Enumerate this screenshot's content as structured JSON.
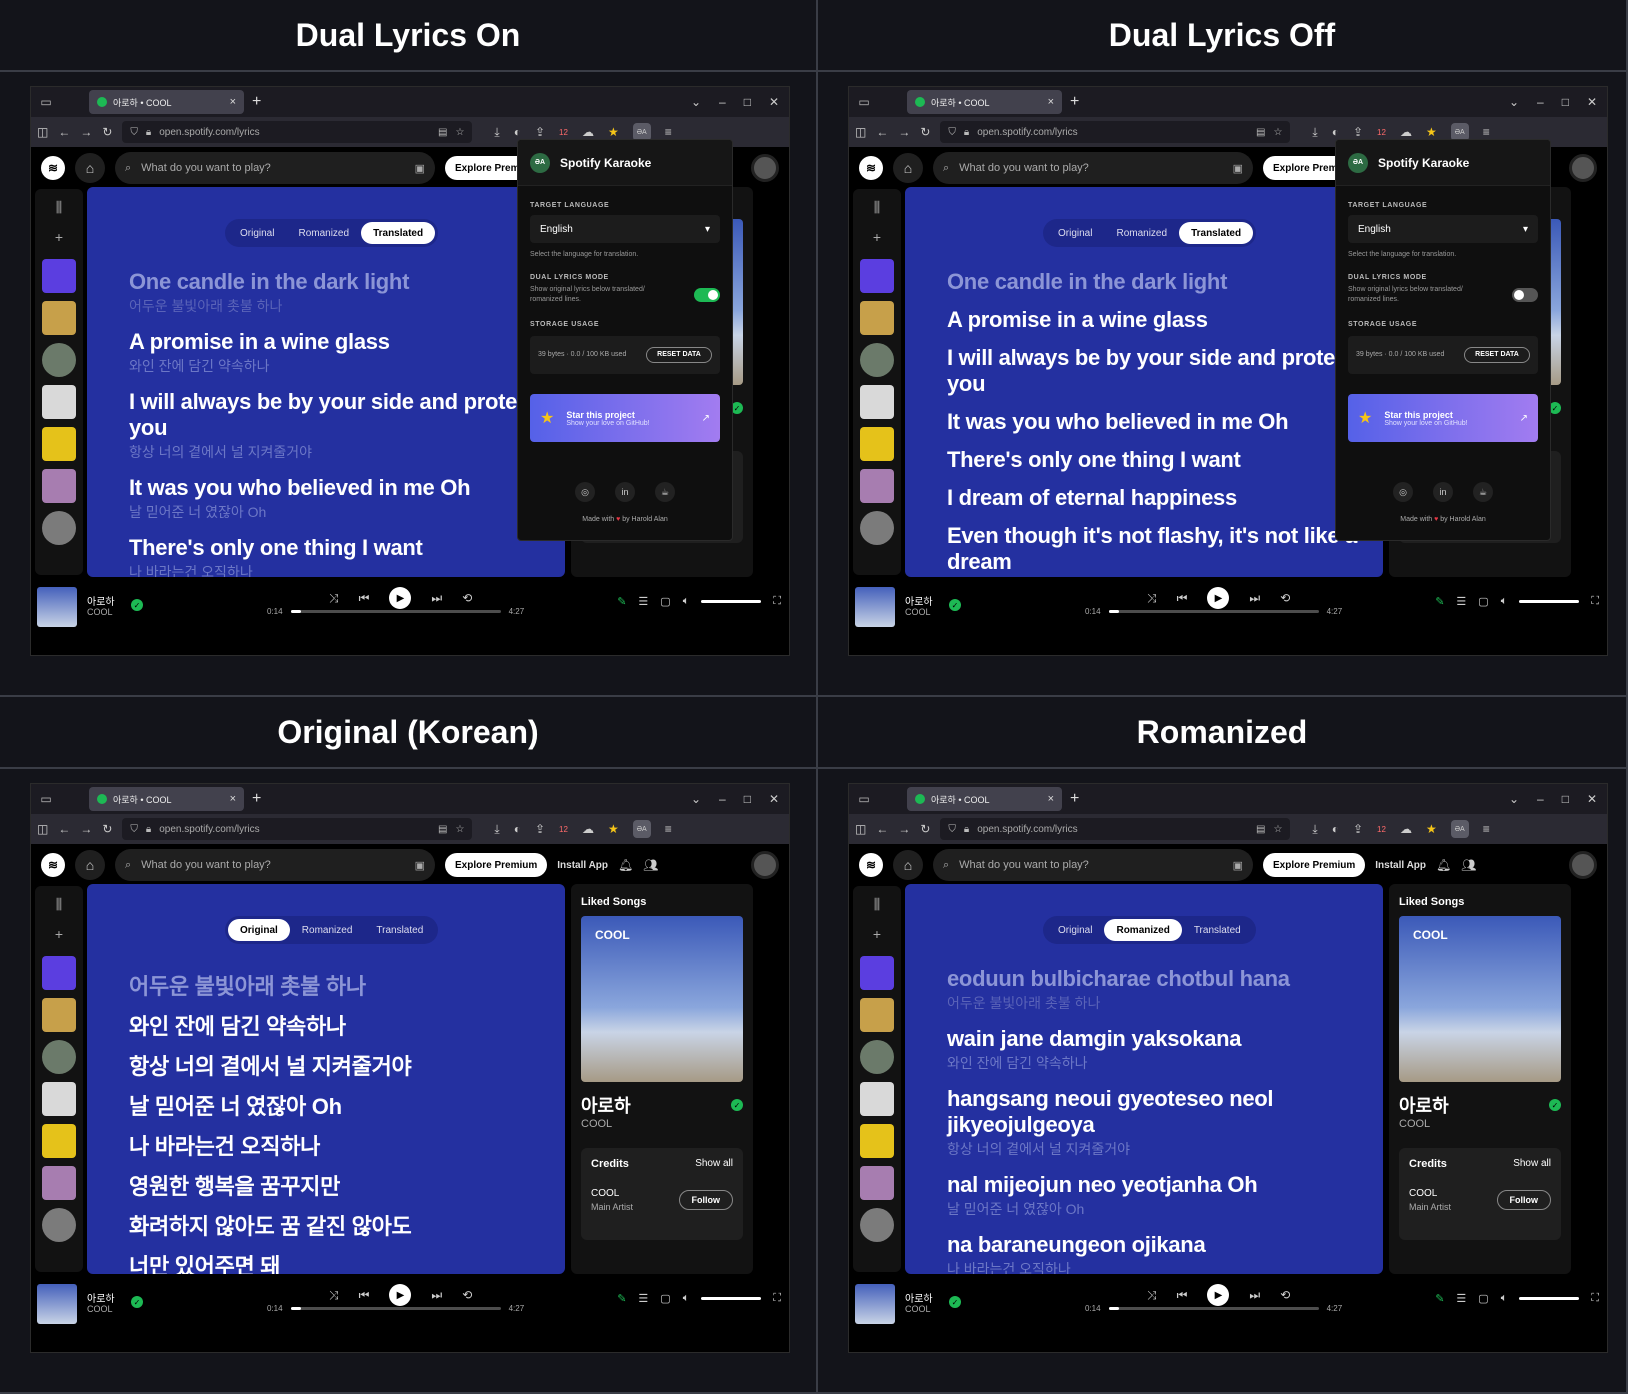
{
  "panels": [
    {
      "heading": "Dual Lyrics On",
      "segment": [
        "Original",
        "Romanized",
        "Translated"
      ],
      "active_segment": 2,
      "lyrics": [
        {
          "main": "One candle in the dark light",
          "sub": "어두운 불빛아래 촛불 하나",
          "dim": true
        },
        {
          "main": "A promise in a wine glass",
          "sub": "와인 잔에 담긴 약속하나",
          "dim": false
        },
        {
          "main": "I will always be by your side and protect you",
          "sub": "항상 너의 곁에서 널 지켜줄거야",
          "dim": false
        },
        {
          "main": "It was you who believed in me Oh",
          "sub": "날 믿어준 너 였잖아 Oh",
          "dim": false
        },
        {
          "main": "There's only one thing I want",
          "sub": "나 바라는건 오직하나",
          "dim": false
        }
      ],
      "popup": true,
      "dual_on": true
    },
    {
      "heading": "Dual Lyrics Off",
      "segment": [
        "Original",
        "Romanized",
        "Translated"
      ],
      "active_segment": 2,
      "lyrics": [
        {
          "main": "One candle in the dark light",
          "sub": "",
          "dim": true
        },
        {
          "main": "A promise in a wine glass",
          "sub": "",
          "dim": false
        },
        {
          "main": "I will always be by your side and protect you",
          "sub": "",
          "dim": false
        },
        {
          "main": "It was you who believed in me Oh",
          "sub": "",
          "dim": false
        },
        {
          "main": "There's only one thing I want",
          "sub": "",
          "dim": false
        },
        {
          "main": "I dream of eternal happiness",
          "sub": "",
          "dim": false
        },
        {
          "main": "Even though it's not flashy, it's not like a dream",
          "sub": "",
          "dim": false
        }
      ],
      "popup": true,
      "dual_on": false
    },
    {
      "heading": "Original (Korean)",
      "segment": [
        "Original",
        "Romanized",
        "Translated"
      ],
      "active_segment": 0,
      "lyrics": [
        {
          "main": "어두운 불빛아래 촛불 하나",
          "sub": "",
          "dim": true
        },
        {
          "main": "와인 잔에 담긴 약속하나",
          "sub": "",
          "dim": false
        },
        {
          "main": "항상 너의 곁에서 널 지켜줄거야",
          "sub": "",
          "dim": false
        },
        {
          "main": "날 믿어준 너 였잖아 Oh",
          "sub": "",
          "dim": false
        },
        {
          "main": "나 바라는건 오직하나",
          "sub": "",
          "dim": false
        },
        {
          "main": "영원한 행복을 꿈꾸지만",
          "sub": "",
          "dim": false
        },
        {
          "main": "화려하지 않아도 꿈 같진 않아도",
          "sub": "",
          "dim": false
        },
        {
          "main": "너만 있어주면 돼",
          "sub": "",
          "dim": false
        }
      ],
      "popup": false,
      "dual_on": false
    },
    {
      "heading": "Romanized",
      "segment": [
        "Original",
        "Romanized",
        "Translated"
      ],
      "active_segment": 1,
      "lyrics": [
        {
          "main": "eoduun bulbicharae chotbul hana",
          "sub": "어두운 불빛아래 촛불 하나",
          "dim": true
        },
        {
          "main": "wain jane damgin yaksokana",
          "sub": "와인 잔에 담긴 약속하나",
          "dim": false
        },
        {
          "main": "hangsang neoui gyeoteseo neol jikyeojulgeoya",
          "sub": "항상 너의 곁에서 널 지켜줄거야",
          "dim": false
        },
        {
          "main": "nal mijeojun neo yeotjanha Oh",
          "sub": "날 믿어준 너 였잖아 Oh",
          "dim": false
        },
        {
          "main": "na baraneungeon ojikana",
          "sub": "나 바라는건 오직하나",
          "dim": false
        }
      ],
      "popup": false,
      "dual_on": false
    }
  ],
  "browser": {
    "tab_title": "아로하 • COOL",
    "url": "open.spotify.com/lyrics",
    "extension_badge": "12"
  },
  "spotify": {
    "search_placeholder": "What do you want to play?",
    "premium": "Explore Premium",
    "install": "Install App",
    "liked_songs": "Liked Songs",
    "art_text": "COOL",
    "song": "아로하",
    "artist": "COOL",
    "credits": "Credits",
    "show_all": "Show all",
    "credit_artist": "COOL",
    "credit_role": "Main Artist",
    "follow": "Follow",
    "elapsed": "0:14",
    "duration": "4:27",
    "progress_fraction": 0.05
  },
  "popup": {
    "title": "Spotify Karaoke",
    "target_label": "TARGET LANGUAGE",
    "language": "English",
    "language_help": "Select the language for translation.",
    "dual_label": "DUAL LYRICS MODE",
    "dual_help": "Show original lyrics below translated/ romanized lines.",
    "storage_label": "STORAGE USAGE",
    "storage_value": "39 bytes · 0.0 / 100 KB used",
    "reset": "RESET DATA",
    "star_title": "Star this project",
    "star_sub": "Show your love on GitHub!",
    "made_prefix": "Made with",
    "made_suffix": "by Harold Alan"
  },
  "colors": {
    "accent": "#1db954",
    "lyrics_bg": "#2430a0",
    "star": "#f5c518"
  }
}
